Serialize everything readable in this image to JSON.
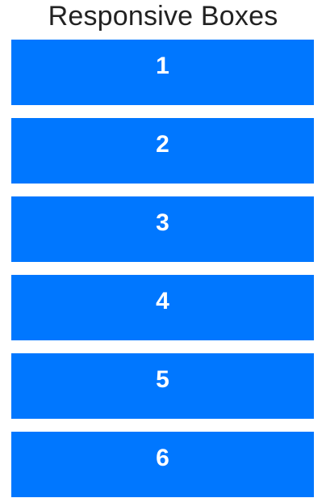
{
  "page": {
    "title": "Responsive Boxes"
  },
  "colors": {
    "box": "#0077ff",
    "box_text": "#ffffff"
  },
  "boxes": [
    {
      "label": "1"
    },
    {
      "label": "2"
    },
    {
      "label": "3"
    },
    {
      "label": "4"
    },
    {
      "label": "5"
    },
    {
      "label": "6"
    }
  ]
}
